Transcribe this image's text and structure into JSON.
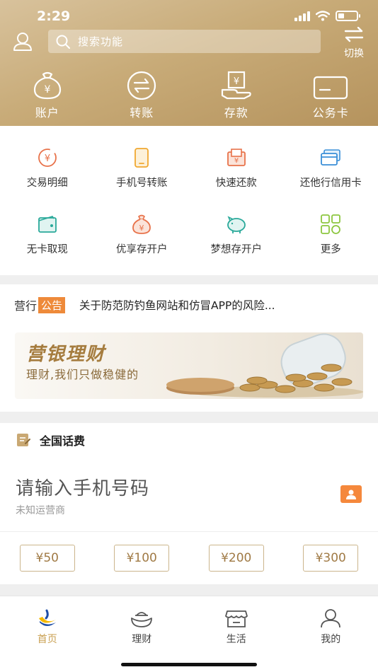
{
  "status_bar": {
    "time": "2:29"
  },
  "header": {
    "search_placeholder": "搜索功能",
    "switch_label": "切换",
    "nav": [
      {
        "label": "账户",
        "icon": "money-bag-icon"
      },
      {
        "label": "转账",
        "icon": "transfer-icon"
      },
      {
        "label": "存款",
        "icon": "deposit-icon"
      },
      {
        "label": "公务卡",
        "icon": "card-icon"
      }
    ]
  },
  "quick": {
    "items": [
      {
        "label": "交易明细",
        "icon": "transaction-detail-icon"
      },
      {
        "label": "手机号转账",
        "icon": "phone-transfer-icon"
      },
      {
        "label": "快速还款",
        "icon": "quick-repay-icon"
      },
      {
        "label": "还他行信用卡",
        "icon": "credit-card-repay-icon"
      },
      {
        "label": "无卡取现",
        "icon": "cardless-withdraw-icon"
      },
      {
        "label": "优享存开户",
        "icon": "savings-bag-icon"
      },
      {
        "label": "梦想存开户",
        "icon": "piggy-bank-icon"
      },
      {
        "label": "更多",
        "icon": "more-grid-icon"
      }
    ]
  },
  "notice": {
    "tag_a": "营行",
    "tag_b": "公告",
    "text": "关于防范防钓鱼网站和仿冒APP的风险..."
  },
  "banner": {
    "title": "营银理财",
    "subtitle": "理财,我们只做稳健的"
  },
  "recharge": {
    "title": "全国话费",
    "input_placeholder": "请输入手机号码",
    "carrier": "未知运营商",
    "amounts": [
      "¥50",
      "¥100",
      "¥200",
      "¥300"
    ]
  },
  "tabbar": {
    "tabs": [
      {
        "label": "首页",
        "active": true
      },
      {
        "label": "理财",
        "active": false
      },
      {
        "label": "生活",
        "active": false
      },
      {
        "label": "我的",
        "active": false
      }
    ]
  },
  "colors": {
    "header_gold": "#c8ab78",
    "accent_orange": "#f5883c",
    "amount_gold": "#a07a45",
    "tab_active": "#c9a052"
  }
}
